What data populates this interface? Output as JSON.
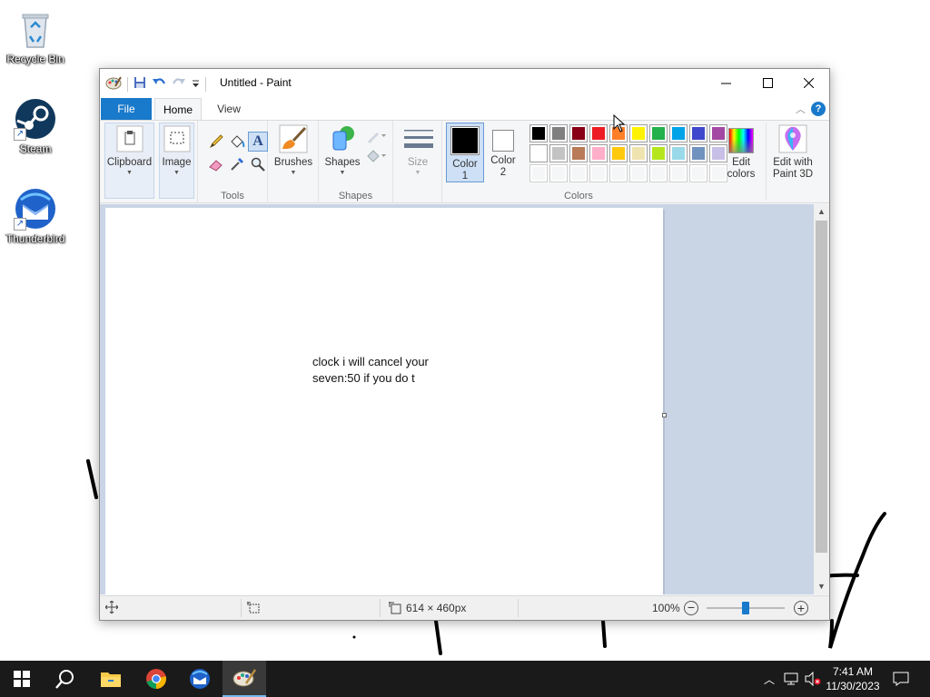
{
  "desktop": {
    "icons": [
      {
        "label": "Recycle Bin"
      },
      {
        "label": "Steam"
      },
      {
        "label": "Thunderbird"
      }
    ]
  },
  "window": {
    "title": "Untitled - Paint",
    "tabs": {
      "file": "File",
      "home": "Home",
      "view": "View"
    },
    "help_label": "?",
    "ribbon": {
      "clipboard": "Clipboard",
      "image": "Image",
      "tools": "Tools",
      "brushes": "Brushes",
      "shapes_btn": "Shapes",
      "shapes_group": "Shapes",
      "size": "Size",
      "color1": "Color",
      "color1_num": "1",
      "color2": "Color",
      "color2_num": "2",
      "colors_group": "Colors",
      "edit_colors_1": "Edit",
      "edit_colors_2": "colors",
      "paint3d_1": "Edit with",
      "paint3d_2": "Paint 3D"
    },
    "palette_row1": [
      "#000000",
      "#7f7f7f",
      "#880015",
      "#ed1c24",
      "#ff7f27",
      "#fff200",
      "#22b14c",
      "#00a2e8",
      "#3f48cc",
      "#a349a4"
    ],
    "palette_row2": [
      "#ffffff",
      "#c3c3c3",
      "#b97a57",
      "#ffaec9",
      "#ffc90e",
      "#efe4b0",
      "#b5e61d",
      "#99d9ea",
      "#7092be",
      "#c8bfe7"
    ],
    "color1_value": "#000000",
    "color2_value": "#ffffff",
    "canvas_text": {
      "line1": "clock i will cancel your",
      "line2": "seven:50 if you do t"
    },
    "status": {
      "dimensions": "614 × 460px",
      "zoom": "100%",
      "zoom_slider_fraction": 0.5
    }
  },
  "taskbar": {
    "time": "7:41 AM",
    "date": "11/30/2023"
  }
}
